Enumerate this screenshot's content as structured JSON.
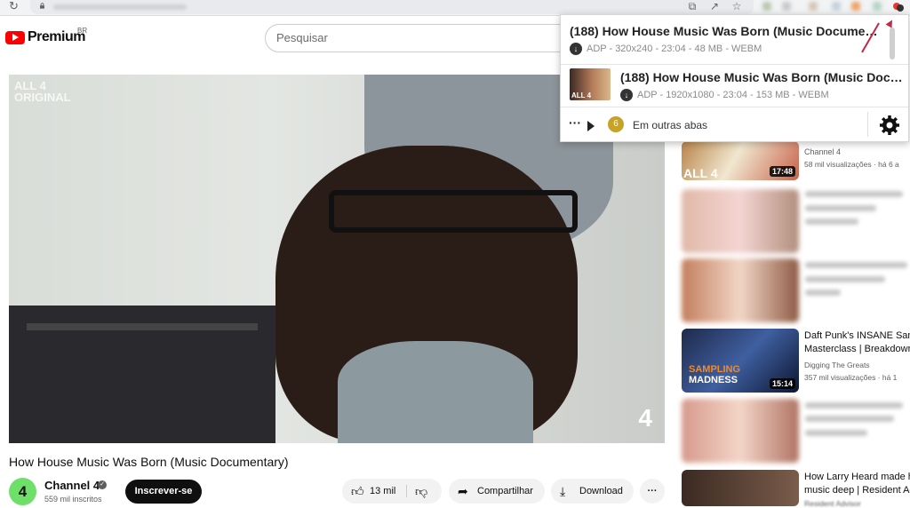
{
  "browser": {
    "reload_icon": "reload-icon",
    "toolbar_icons": [
      "install-app-icon",
      "share-icon",
      "bookmark-star-icon"
    ]
  },
  "youtube": {
    "logo_text": "Premium",
    "logo_region": "BR",
    "search_placeholder": "Pesquisar"
  },
  "video": {
    "watermark": "ALL 4\nORIGINAL",
    "corner_logo": "4",
    "title": "How House Music Was Born (Music Documentary)",
    "channel": {
      "name": "Channel 4",
      "avatar": "4",
      "subscribers": "559 mil inscritos",
      "subscribe_label": "Inscrever-se"
    },
    "actions": {
      "likes": "13 mil",
      "share": "Compartilhar",
      "download": "Download",
      "more": "···"
    }
  },
  "popup": {
    "items": [
      {
        "title": "(188) How House Music Was Born (Music Documentary)",
        "meta": "ADP - 320x240 - 23:04 - 48 MB - WEBM"
      },
      {
        "title": "(188) How House Music Was Born (Music Documentary)",
        "meta": "ADP - 1920x1080 - 23:04 - 153 MB - WEBM",
        "thumb_label": "ALL 4"
      }
    ],
    "footer": {
      "dots": "···",
      "count": "6",
      "label": "Em outras abas"
    }
  },
  "sidebar": {
    "items": [
      {
        "channel": "Channel 4",
        "meta": "58 mil visualizações · há 6 a",
        "duration": "17:48",
        "thumb_label": "ALL 4"
      },
      {
        "blurred": true
      },
      {
        "blurred": true
      },
      {
        "title1": "Daft Punk's INSANE Sam",
        "title2": "Masterclass | Breakdown",
        "channel": "Digging The Greats",
        "meta": "357 mil visualizações · há 1",
        "duration": "15:14",
        "thumb_text1": "SAMPLING",
        "thumb_text2": "MADNESS"
      },
      {
        "blurred": true
      },
      {
        "title1": "How Larry Heard made h",
        "title2": "music deep | Resident Ad",
        "channel": "Resident Advisor"
      }
    ]
  },
  "colors": {
    "youtube_red": "#ff0000",
    "badge_gold": "#c6a227",
    "annotation_arrow": "#c1284a"
  }
}
